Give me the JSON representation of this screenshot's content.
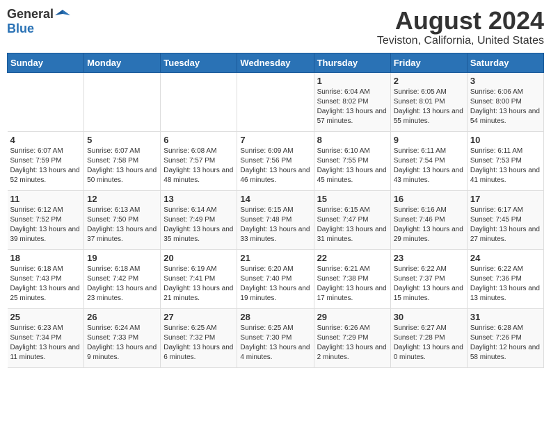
{
  "header": {
    "logo_general": "General",
    "logo_blue": "Blue",
    "title": "August 2024",
    "subtitle": "Teviston, California, United States"
  },
  "days_of_week": [
    "Sunday",
    "Monday",
    "Tuesday",
    "Wednesday",
    "Thursday",
    "Friday",
    "Saturday"
  ],
  "weeks": [
    [
      {
        "day": "",
        "sunrise": "",
        "sunset": "",
        "daylight": ""
      },
      {
        "day": "",
        "sunrise": "",
        "sunset": "",
        "daylight": ""
      },
      {
        "day": "",
        "sunrise": "",
        "sunset": "",
        "daylight": ""
      },
      {
        "day": "",
        "sunrise": "",
        "sunset": "",
        "daylight": ""
      },
      {
        "day": "1",
        "sunrise": "Sunrise: 6:04 AM",
        "sunset": "Sunset: 8:02 PM",
        "daylight": "Daylight: 13 hours and 57 minutes."
      },
      {
        "day": "2",
        "sunrise": "Sunrise: 6:05 AM",
        "sunset": "Sunset: 8:01 PM",
        "daylight": "Daylight: 13 hours and 55 minutes."
      },
      {
        "day": "3",
        "sunrise": "Sunrise: 6:06 AM",
        "sunset": "Sunset: 8:00 PM",
        "daylight": "Daylight: 13 hours and 54 minutes."
      }
    ],
    [
      {
        "day": "4",
        "sunrise": "Sunrise: 6:07 AM",
        "sunset": "Sunset: 7:59 PM",
        "daylight": "Daylight: 13 hours and 52 minutes."
      },
      {
        "day": "5",
        "sunrise": "Sunrise: 6:07 AM",
        "sunset": "Sunset: 7:58 PM",
        "daylight": "Daylight: 13 hours and 50 minutes."
      },
      {
        "day": "6",
        "sunrise": "Sunrise: 6:08 AM",
        "sunset": "Sunset: 7:57 PM",
        "daylight": "Daylight: 13 hours and 48 minutes."
      },
      {
        "day": "7",
        "sunrise": "Sunrise: 6:09 AM",
        "sunset": "Sunset: 7:56 PM",
        "daylight": "Daylight: 13 hours and 46 minutes."
      },
      {
        "day": "8",
        "sunrise": "Sunrise: 6:10 AM",
        "sunset": "Sunset: 7:55 PM",
        "daylight": "Daylight: 13 hours and 45 minutes."
      },
      {
        "day": "9",
        "sunrise": "Sunrise: 6:11 AM",
        "sunset": "Sunset: 7:54 PM",
        "daylight": "Daylight: 13 hours and 43 minutes."
      },
      {
        "day": "10",
        "sunrise": "Sunrise: 6:11 AM",
        "sunset": "Sunset: 7:53 PM",
        "daylight": "Daylight: 13 hours and 41 minutes."
      }
    ],
    [
      {
        "day": "11",
        "sunrise": "Sunrise: 6:12 AM",
        "sunset": "Sunset: 7:52 PM",
        "daylight": "Daylight: 13 hours and 39 minutes."
      },
      {
        "day": "12",
        "sunrise": "Sunrise: 6:13 AM",
        "sunset": "Sunset: 7:50 PM",
        "daylight": "Daylight: 13 hours and 37 minutes."
      },
      {
        "day": "13",
        "sunrise": "Sunrise: 6:14 AM",
        "sunset": "Sunset: 7:49 PM",
        "daylight": "Daylight: 13 hours and 35 minutes."
      },
      {
        "day": "14",
        "sunrise": "Sunrise: 6:15 AM",
        "sunset": "Sunset: 7:48 PM",
        "daylight": "Daylight: 13 hours and 33 minutes."
      },
      {
        "day": "15",
        "sunrise": "Sunrise: 6:15 AM",
        "sunset": "Sunset: 7:47 PM",
        "daylight": "Daylight: 13 hours and 31 minutes."
      },
      {
        "day": "16",
        "sunrise": "Sunrise: 6:16 AM",
        "sunset": "Sunset: 7:46 PM",
        "daylight": "Daylight: 13 hours and 29 minutes."
      },
      {
        "day": "17",
        "sunrise": "Sunrise: 6:17 AM",
        "sunset": "Sunset: 7:45 PM",
        "daylight": "Daylight: 13 hours and 27 minutes."
      }
    ],
    [
      {
        "day": "18",
        "sunrise": "Sunrise: 6:18 AM",
        "sunset": "Sunset: 7:43 PM",
        "daylight": "Daylight: 13 hours and 25 minutes."
      },
      {
        "day": "19",
        "sunrise": "Sunrise: 6:18 AM",
        "sunset": "Sunset: 7:42 PM",
        "daylight": "Daylight: 13 hours and 23 minutes."
      },
      {
        "day": "20",
        "sunrise": "Sunrise: 6:19 AM",
        "sunset": "Sunset: 7:41 PM",
        "daylight": "Daylight: 13 hours and 21 minutes."
      },
      {
        "day": "21",
        "sunrise": "Sunrise: 6:20 AM",
        "sunset": "Sunset: 7:40 PM",
        "daylight": "Daylight: 13 hours and 19 minutes."
      },
      {
        "day": "22",
        "sunrise": "Sunrise: 6:21 AM",
        "sunset": "Sunset: 7:38 PM",
        "daylight": "Daylight: 13 hours and 17 minutes."
      },
      {
        "day": "23",
        "sunrise": "Sunrise: 6:22 AM",
        "sunset": "Sunset: 7:37 PM",
        "daylight": "Daylight: 13 hours and 15 minutes."
      },
      {
        "day": "24",
        "sunrise": "Sunrise: 6:22 AM",
        "sunset": "Sunset: 7:36 PM",
        "daylight": "Daylight: 13 hours and 13 minutes."
      }
    ],
    [
      {
        "day": "25",
        "sunrise": "Sunrise: 6:23 AM",
        "sunset": "Sunset: 7:34 PM",
        "daylight": "Daylight: 13 hours and 11 minutes."
      },
      {
        "day": "26",
        "sunrise": "Sunrise: 6:24 AM",
        "sunset": "Sunset: 7:33 PM",
        "daylight": "Daylight: 13 hours and 9 minutes."
      },
      {
        "day": "27",
        "sunrise": "Sunrise: 6:25 AM",
        "sunset": "Sunset: 7:32 PM",
        "daylight": "Daylight: 13 hours and 6 minutes."
      },
      {
        "day": "28",
        "sunrise": "Sunrise: 6:25 AM",
        "sunset": "Sunset: 7:30 PM",
        "daylight": "Daylight: 13 hours and 4 minutes."
      },
      {
        "day": "29",
        "sunrise": "Sunrise: 6:26 AM",
        "sunset": "Sunset: 7:29 PM",
        "daylight": "Daylight: 13 hours and 2 minutes."
      },
      {
        "day": "30",
        "sunrise": "Sunrise: 6:27 AM",
        "sunset": "Sunset: 7:28 PM",
        "daylight": "Daylight: 13 hours and 0 minutes."
      },
      {
        "day": "31",
        "sunrise": "Sunrise: 6:28 AM",
        "sunset": "Sunset: 7:26 PM",
        "daylight": "Daylight: 12 hours and 58 minutes."
      }
    ]
  ]
}
